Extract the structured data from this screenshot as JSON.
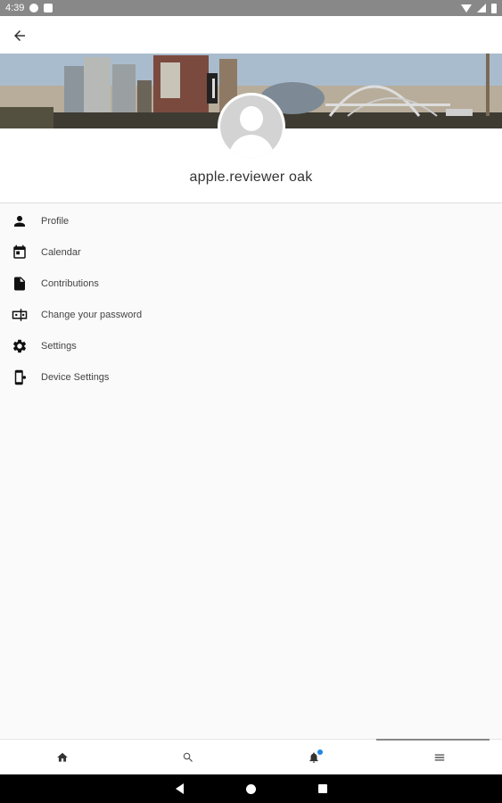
{
  "status_bar": {
    "time": "4:39"
  },
  "profile": {
    "name": "apple.reviewer oak"
  },
  "menu": {
    "items": [
      {
        "label": "Profile",
        "icon": "person-icon"
      },
      {
        "label": "Calendar",
        "icon": "calendar-icon"
      },
      {
        "label": "Contributions",
        "icon": "document-icon"
      },
      {
        "label": "Change your password",
        "icon": "password-icon"
      },
      {
        "label": "Settings",
        "icon": "gear-icon"
      },
      {
        "label": "Device Settings",
        "icon": "device-settings-icon"
      }
    ]
  },
  "bottom_nav": {
    "tabs": [
      {
        "name": "home",
        "icon": "home-icon"
      },
      {
        "name": "search",
        "icon": "search-icon"
      },
      {
        "name": "notifications",
        "icon": "bell-icon",
        "badge": true
      },
      {
        "name": "menu",
        "icon": "hamburger-icon",
        "active": true
      }
    ]
  },
  "colors": {
    "accent": "#1e88e5",
    "status_bar": "#888888",
    "background": "#fafafa"
  }
}
